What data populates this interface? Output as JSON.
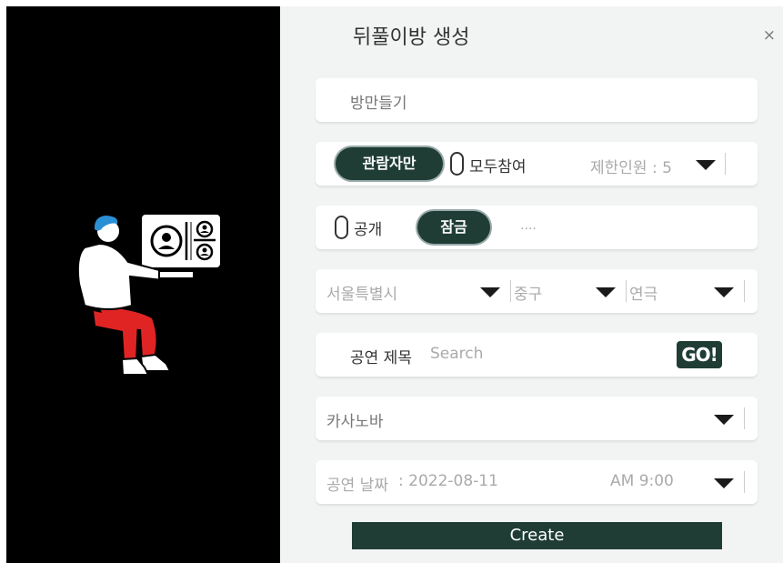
{
  "dialog": {
    "title": "뒤풀이방 생성",
    "close_icon": "×"
  },
  "room_name": {
    "placeholder": "방만들기"
  },
  "participation": {
    "spectator_label": "관람자만",
    "all_label": "모두참여",
    "limit_label": "제한인원 : 5"
  },
  "privacy": {
    "public_label": "공개",
    "locked_label": "잠금",
    "password_mask": "...."
  },
  "region": {
    "city": "서울특별시",
    "district": "중구",
    "genre": "연극"
  },
  "performance_search": {
    "label": "공연 제목",
    "placeholder": "Search",
    "go_label": "GO!"
  },
  "performance": {
    "selected": "카사노바"
  },
  "date": {
    "label": "공연 날짜",
    "value": " : 2022-08-11",
    "time": "AM 9:00"
  },
  "create_button": {
    "label": "Create"
  },
  "colors": {
    "accent": "#1f3d35",
    "background": "#f2f3f3",
    "left_panel": "#000000",
    "illustration_red": "#e02424",
    "illustration_blue": "#2b8fd6"
  },
  "icons": [
    "close-icon",
    "dropdown-arrow-icon",
    "toggle-oval-icon",
    "person-with-screen-illustration"
  ]
}
